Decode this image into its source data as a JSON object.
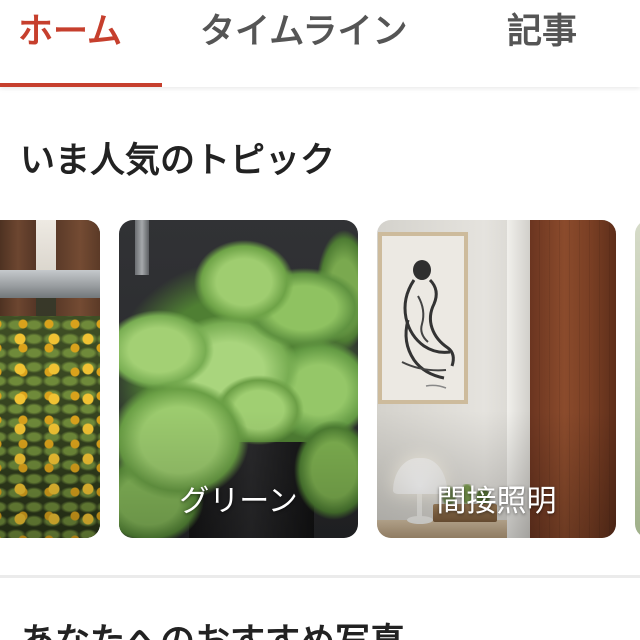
{
  "tabs": [
    {
      "label": "ホーム",
      "active": true
    },
    {
      "label": "タイムライン",
      "active": false
    },
    {
      "label": "記事",
      "active": false
    }
  ],
  "colors": {
    "accent": "#c63f2d",
    "tab_inactive": "#555555",
    "heading": "#222222",
    "card_label": "#ffffff"
  },
  "popular_topics": {
    "title": "いま人気のトピック",
    "cards": [
      {
        "label": ""
      },
      {
        "label": "グリーン"
      },
      {
        "label": "間接照明"
      },
      {
        "label": ""
      }
    ]
  },
  "recommended": {
    "title": "あなたへのおすすめ写真"
  }
}
